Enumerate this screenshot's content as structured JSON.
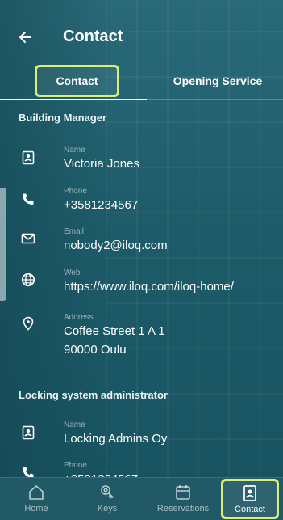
{
  "header": {
    "title": "Contact"
  },
  "tabs": [
    {
      "label": "Contact",
      "active": true
    },
    {
      "label": "Opening Service",
      "active": false
    }
  ],
  "sections": [
    {
      "title": "Building Manager",
      "fields": [
        {
          "label": "Name",
          "value": "Victoria Jones",
          "icon": "contact-card-icon"
        },
        {
          "label": "Phone",
          "value": "+3581234567",
          "icon": "phone-icon"
        },
        {
          "label": "Email",
          "value": "nobody2@iloq.com",
          "icon": "mail-icon"
        },
        {
          "label": "Web",
          "value": "https://www.iloq.com/iloq-home/",
          "icon": "globe-icon"
        },
        {
          "label": "Address",
          "value": "Coffee Street 1 A 1",
          "value2": "90000 Oulu",
          "icon": "location-pin-icon"
        }
      ]
    },
    {
      "title": "Locking system administrator",
      "fields": [
        {
          "label": "Name",
          "value": "Locking Admins Oy",
          "icon": "contact-card-icon"
        },
        {
          "label": "Phone",
          "value": "+3581234567",
          "icon": "phone-icon"
        }
      ]
    }
  ],
  "nav": [
    {
      "label": "Home",
      "icon": "home-icon"
    },
    {
      "label": "Keys",
      "icon": "key-icon"
    },
    {
      "label": "Reservations",
      "icon": "calendar-icon"
    },
    {
      "label": "Contact",
      "icon": "contact-card-icon",
      "active": true
    }
  ],
  "colors": {
    "highlight": "#d9ef7a",
    "background": "#1f5f6b"
  }
}
